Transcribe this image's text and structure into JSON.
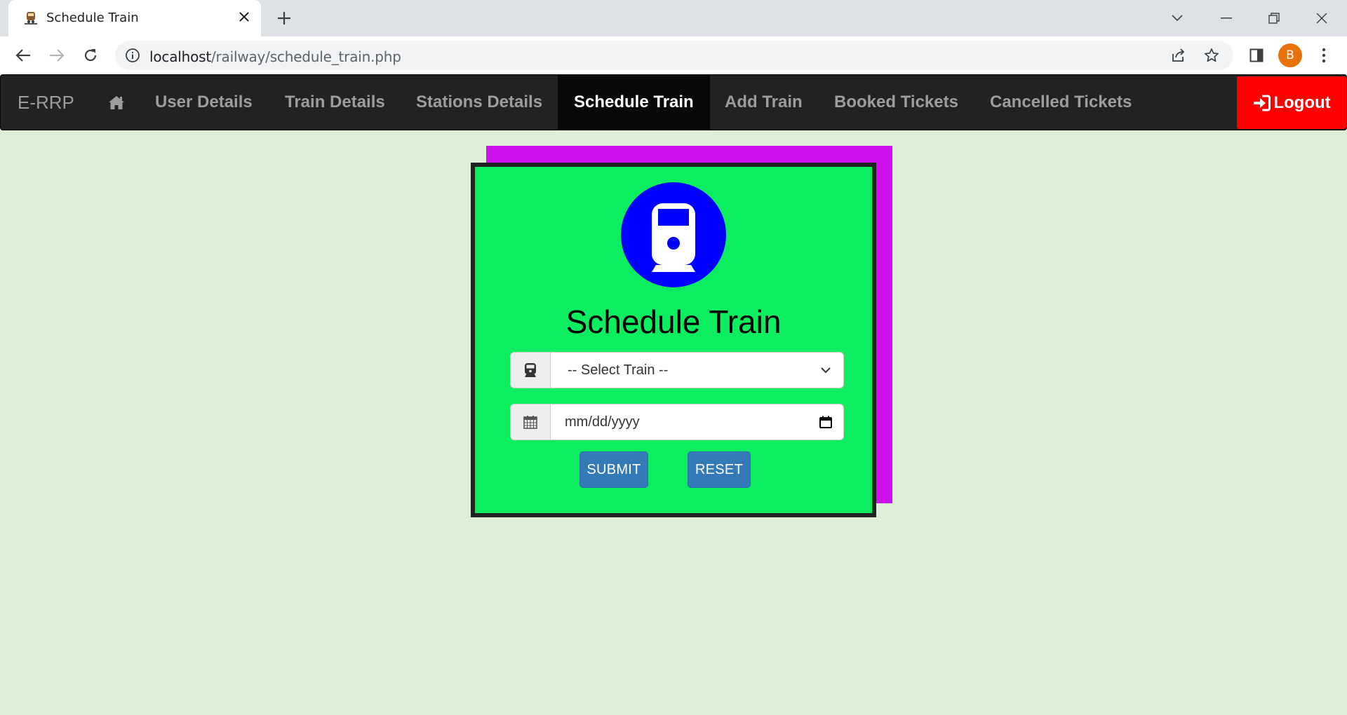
{
  "browser": {
    "tab_title": "Schedule Train",
    "url_host": "localhost",
    "url_path": "/railway/schedule_train.php",
    "profile_initial": "B"
  },
  "navbar": {
    "brand": "E-RRP",
    "items": [
      {
        "label": "User Details"
      },
      {
        "label": "Train Details"
      },
      {
        "label": "Stations Details"
      },
      {
        "label": "Schedule Train",
        "active": true
      },
      {
        "label": "Add Train"
      },
      {
        "label": "Booked Tickets"
      },
      {
        "label": "Cancelled Tickets"
      }
    ],
    "logout_label": "Logout"
  },
  "form": {
    "title": "Schedule Train",
    "train_select_value": "-- Select Train --",
    "date_placeholder": "mm/dd/yyyy",
    "submit_label": "SUBMIT",
    "reset_label": "RESET"
  },
  "colors": {
    "page_bg": "#deefd8",
    "card_bg": "#0ded60",
    "card_shadow": "#cc11ee",
    "logo_circle": "#0000ff",
    "logout_bg": "#ff0000",
    "button_bg": "#337ab7",
    "navbar_bg": "#222222"
  },
  "icons": {
    "tab_favicon": "train-favicon-icon",
    "home": "home-icon",
    "logout": "sign-in-icon",
    "train_addon": "train-icon",
    "date_addon": "calendar-icon"
  }
}
